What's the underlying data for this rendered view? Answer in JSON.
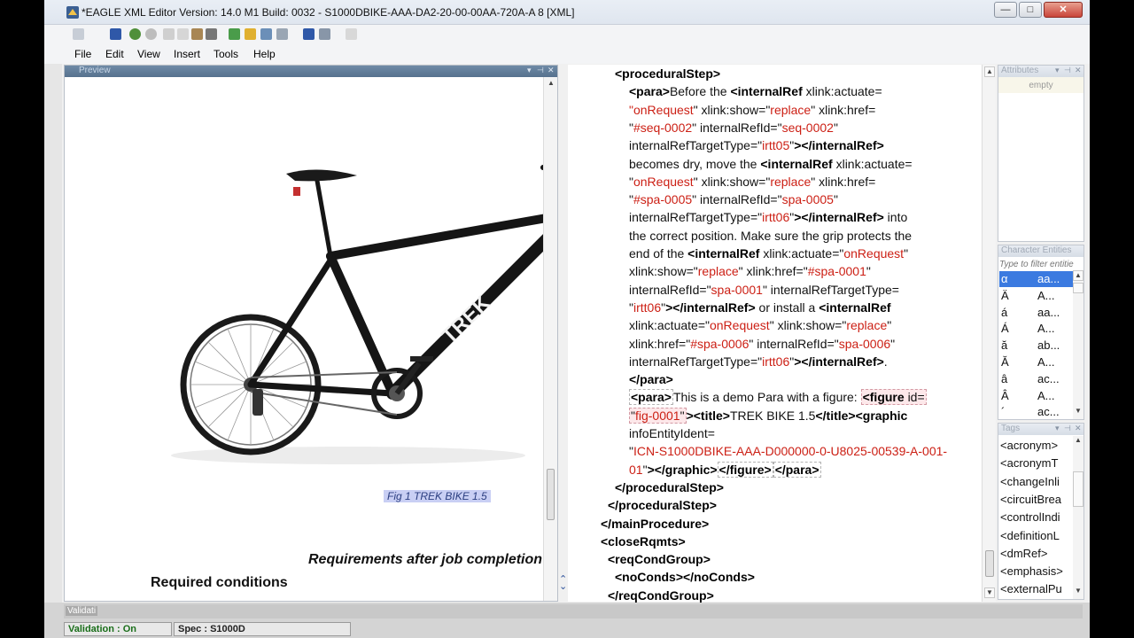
{
  "window": {
    "title": "*EAGLE XML Editor Version: 14.0 M1 Build: 0032 - S1000DBIKE-AAA-DA2-20-00-00AA-720A-A 8 [XML]",
    "min_label": "—",
    "max_label": "□",
    "close_label": "✕"
  },
  "menu": [
    "File",
    "Edit",
    "View",
    "Insert",
    "Tools",
    "Help"
  ],
  "preview": {
    "title": "Preview",
    "figure_caption": "Fig 1 TREK BIKE 1.5",
    "bike_brand": "TREK",
    "requirements_after": "Requirements after job completion",
    "required_conditions": "Required conditions"
  },
  "xml_lines": [
    {
      "indent": 1,
      "html": "<span class='tag'>&lt;proceduralStep&gt;</span>"
    },
    {
      "indent": 2,
      "html": "<span class='tag'>&lt;para&gt;</span>Before the <span class='tag'>&lt;internalRef</span> <span class='attr'>xlink:actuate=</span>"
    },
    {
      "indent": 2,
      "html": "<span class='val'>\"onRequest</span>\" <span class='attr'>xlink:show=</span>\"<span class='val'>replace</span>\" <span class='attr'>xlink:href=</span>"
    },
    {
      "indent": 2,
      "html": "\"<span class='val'>#seq-0002</span>\" <span class='attr'>internalRefId=</span>\"<span class='val'>seq-0002</span>\""
    },
    {
      "indent": 2,
      "html": "<span class='attr'>internalRefTargetType=</span>\"<span class='val'>irtt05</span>\"<span class='tag'>&gt;&lt;/internalRef&gt;</span>"
    },
    {
      "indent": 2,
      "html": "becomes dry, move the <span class='tag'>&lt;internalRef</span> <span class='attr'>xlink:actuate=</span>"
    },
    {
      "indent": 2,
      "html": "\"<span class='val'>onRequest</span>\" <span class='attr'>xlink:show=</span>\"<span class='val'>replace</span>\" <span class='attr'>xlink:href=</span>"
    },
    {
      "indent": 2,
      "html": "\"<span class='val'>#spa-0005</span>\" <span class='attr'>internalRefId=</span>\"<span class='val'>spa-0005</span>\""
    },
    {
      "indent": 2,
      "html": "<span class='attr'>internalRefTargetType=</span>\"<span class='val'>irtt06</span>\"<span class='tag'>&gt;&lt;/internalRef&gt;</span> into"
    },
    {
      "indent": 2,
      "html": "the correct position. Make sure the grip protects the"
    },
    {
      "indent": 2,
      "html": "end of the <span class='tag'>&lt;internalRef</span> <span class='attr'>xlink:actuate=</span>\"<span class='val'>onRequest</span>\""
    },
    {
      "indent": 2,
      "html": "<span class='attr'>xlink:show=</span>\"<span class='val'>replace</span>\" <span class='attr'>xlink:href=</span>\"<span class='val'>#spa-0001</span>\""
    },
    {
      "indent": 2,
      "html": "<span class='attr'>internalRefId=</span>\"<span class='val'>spa-0001</span>\" <span class='attr'>internalRefTargetType=</span>"
    },
    {
      "indent": 2,
      "html": "\"<span class='val'>irtt06</span>\"<span class='tag'>&gt;&lt;/internalRef&gt;</span> or install a <span class='tag'>&lt;internalRef</span>"
    },
    {
      "indent": 2,
      "html": "<span class='attr'>xlink:actuate=</span>\"<span class='val'>onRequest</span>\" <span class='attr'>xlink:show=</span>\"<span class='val'>replace</span>\""
    },
    {
      "indent": 2,
      "html": "<span class='attr'>xlink:href=</span>\"<span class='val'>#spa-0006</span>\" <span class='attr'>internalRefId=</span>\"<span class='val'>spa-0006</span>\""
    },
    {
      "indent": 2,
      "html": "<span class='attr'>internalRefTargetType=</span>\"<span class='val'>irtt06</span>\"<span class='tag'>&gt;&lt;/internalRef&gt;</span>."
    },
    {
      "indent": 2,
      "html": "<span class='tag'>&lt;/para&gt;</span>"
    },
    {
      "indent": 2,
      "html": "<span class='tag boxed'>&lt;para&gt;</span>This is a demo Para with a figure: <span class='tag boxed boxed-pink'>&lt;figure <span class='attr' style='font-weight:normal'>id=</span></span>"
    },
    {
      "indent": 2,
      "html": "<span class='boxed boxed-pink'>\"<span class='val'>fig-0001</span>\"</span><span class='tag'>&gt;&lt;title&gt;</span>TREK BIKE 1.5<span class='tag'>&lt;/title&gt;&lt;graphic</span>"
    },
    {
      "indent": 2,
      "html": "<span class='attr'>infoEntityIdent=</span>"
    },
    {
      "indent": 2,
      "html": "\"<span class='val'>ICN-S1000DBIKE-AAA-D000000-0-U8025-00539-A-001-</span>"
    },
    {
      "indent": 2,
      "html": "<span class='val'>01</span>\"<span class='tag'>&gt;&lt;/graphic&gt;</span><span class='tag boxed'>&lt;/figure&gt;</span><span class='tag boxed'>&lt;/para&gt;</span>"
    },
    {
      "indent": 1,
      "html": "<span class='tag'>&lt;/proceduralStep&gt;</span>"
    },
    {
      "indent": 0.5,
      "html": "<span class='tag'>&lt;/proceduralStep&gt;</span>"
    },
    {
      "indent": 0,
      "html": "<span class='tag'>&lt;/mainProcedure&gt;</span>"
    },
    {
      "indent": 0,
      "html": "<span class='tag'>&lt;closeRqmts&gt;</span>"
    },
    {
      "indent": 0.5,
      "html": "<span class='tag'>&lt;reqCondGroup&gt;</span>"
    },
    {
      "indent": 1,
      "html": "<span class='tag'>&lt;noConds&gt;&lt;/noConds&gt;</span>"
    },
    {
      "indent": 0.5,
      "html": "<span class='tag'>&lt;/reqCondGroup&gt;</span>"
    }
  ],
  "attributes_panel": {
    "title": "Attributes",
    "empty_label": "empty"
  },
  "char_panel": {
    "title": "Character Entities",
    "filter_placeholder": "Type to filter entitie",
    "rows": [
      {
        "glyph": "α",
        "name": "aa..."
      },
      {
        "glyph": "Ä",
        "name": "A..."
      },
      {
        "glyph": "á",
        "name": "aa..."
      },
      {
        "glyph": "Á",
        "name": "A..."
      },
      {
        "glyph": "ă",
        "name": "ab..."
      },
      {
        "glyph": "Ă",
        "name": "A..."
      },
      {
        "glyph": "â",
        "name": "ac..."
      },
      {
        "glyph": "Â",
        "name": "A..."
      },
      {
        "glyph": "´",
        "name": "ac..."
      }
    ]
  },
  "tags_panel": {
    "title": "Tags",
    "items": [
      "<acronym>",
      "<acronymT",
      "<changeInli",
      "<circuitBrea",
      "<controlIndi",
      "<definitionL",
      "<dmRef>",
      "<emphasis>",
      "<externalPu"
    ]
  },
  "status": {
    "validate_tab": "Validati",
    "validation": "Validation : On",
    "spec": "Spec : S1000D"
  },
  "colors": {
    "tag_value": "#cc1f14",
    "selection": "#3b7ae0",
    "caption_bg": "#c9cff4"
  }
}
